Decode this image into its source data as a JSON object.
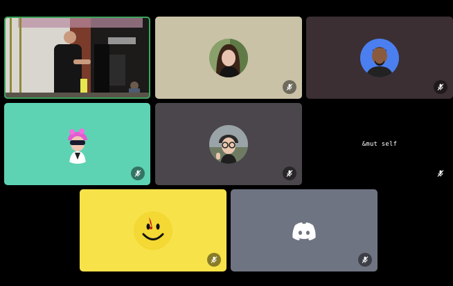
{
  "call": {
    "participants": [
      {
        "id": "p1",
        "kind": "video",
        "muted": false
      },
      {
        "id": "p2",
        "kind": "avatar",
        "tile_color": "#c9c2a7",
        "muted": true
      },
      {
        "id": "p3",
        "kind": "avatar",
        "tile_color": "#3b2f33",
        "muted": true
      },
      {
        "id": "p4",
        "kind": "avatar",
        "tile_color": "#5ed3b4",
        "muted": true
      },
      {
        "id": "p5",
        "kind": "avatar",
        "tile_color": "#4a464b",
        "muted": true
      },
      {
        "id": "p6",
        "kind": "text-avatar",
        "tile_color": "#000000",
        "avatar_text": "&mut self",
        "muted": true
      },
      {
        "id": "p7",
        "kind": "avatar",
        "tile_color": "#f7e24a",
        "muted": true
      },
      {
        "id": "p8",
        "kind": "avatar",
        "tile_color": "#6f7482",
        "muted": true
      }
    ]
  },
  "colors": {
    "background": "#000000",
    "active_speaker_border": "#3ba55d",
    "discord_blurple": "#5865f2"
  },
  "icons": {
    "mute": "microphone-muted-icon",
    "discord": "discord-logo-icon"
  }
}
